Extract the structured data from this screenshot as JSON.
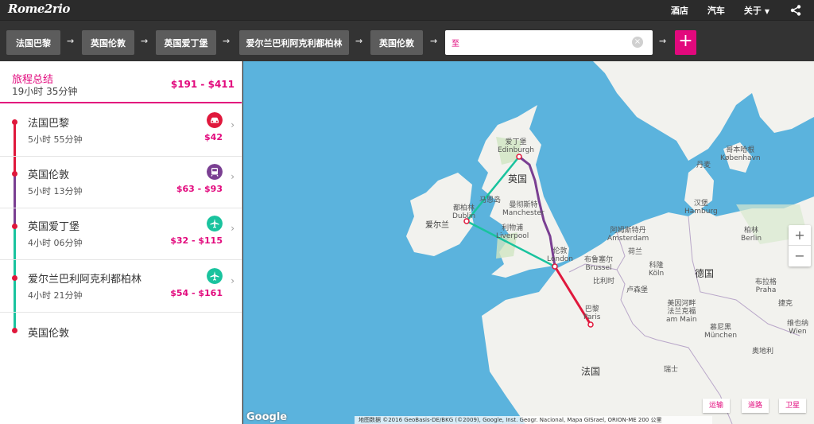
{
  "app": {
    "logo": "Rome2rio"
  },
  "topnav": {
    "hotels": "酒店",
    "cars": "汽车",
    "about": "关于"
  },
  "route": {
    "stops": [
      "法国巴黎",
      "英国伦敦",
      "英国爱丁堡",
      "爱尔兰巴利阿克利都柏林",
      "英国伦敦"
    ],
    "search_value": "至"
  },
  "summary": {
    "title": "旅程总结",
    "duration": "19小时 35分钟",
    "price": "$191 - $411"
  },
  "legs": [
    {
      "name": "法国巴黎",
      "duration": "5小时 55分钟",
      "price": "$42",
      "mode": "car-icon",
      "color": "#e0183c"
    },
    {
      "name": "英国伦敦",
      "duration": "5小时 13分钟",
      "price": "$63 - $93",
      "mode": "train-icon",
      "color": "#7a3f92"
    },
    {
      "name": "英国爱丁堡",
      "duration": "4小时 06分钟",
      "price": "$32 - $115",
      "mode": "plane-icon",
      "color": "#19c39e"
    },
    {
      "name": "爱尔兰巴利阿克利都柏林",
      "duration": "4小时 21分钟",
      "price": "$54 - $161",
      "mode": "plane-icon",
      "color": "#19c39e"
    }
  ],
  "final_stop": "英国伦敦",
  "map": {
    "labels": {
      "edinburgh_cn": "爱丁堡",
      "edinburgh": "Edinburgh",
      "uk": "英国",
      "isle_of_man": "马恩岛",
      "manchester_cn": "曼彻斯特",
      "manchester": "Manchester",
      "dublin_cn": "都柏林",
      "dublin": "Dublin",
      "liverpool_cn": "利物浦",
      "liverpool": "Liverpool",
      "ireland": "爱尔兰",
      "london_cn": "伦敦",
      "london": "London",
      "paris_cn": "巴黎",
      "paris": "Paris",
      "france": "法国",
      "germany": "德国",
      "copenhagen_cn": "哥本哈根",
      "copenhagen": "København",
      "denmark": "丹麦",
      "hamburg_cn": "汉堡",
      "hamburg": "Hamburg",
      "berlin_cn": "柏林",
      "berlin": "Berlin",
      "amsterdam_cn": "阿姆斯特丹",
      "amsterdam": "Amsterdam",
      "netherlands": "荷兰",
      "brussels_cn": "布鲁塞尔",
      "brussels": "Brussel",
      "belgium": "比利时",
      "cologne_cn": "科隆",
      "cologne": "Köln",
      "luxembourg": "卢森堡",
      "frankfurt_cn": "美因河畔",
      "frankfurt": "法兰克福",
      "frankfurt_de": "am Main",
      "munich_cn": "慕尼黑",
      "munich": "München",
      "prague_cn": "布拉格",
      "prague": "Praha",
      "czech": "捷克",
      "austria": "奥地利",
      "switzerland": "瑞士",
      "vienna_cn": "维也纳",
      "vienna": "Wien"
    },
    "zoom_in": "+",
    "zoom_out": "−",
    "types": [
      "运输",
      "道路",
      "卫星"
    ],
    "google": "Google",
    "attribution": "地图数据 ©2016 GeoBasis-DE/BKG (©2009), Google, Inst. Geogr. Nacional, Mapa GISrael, ORION-ME   200 公里"
  },
  "colors": {
    "accent": "#e2097d",
    "car": "#e0183c",
    "train": "#7a3f92",
    "plane": "#19c39e"
  }
}
